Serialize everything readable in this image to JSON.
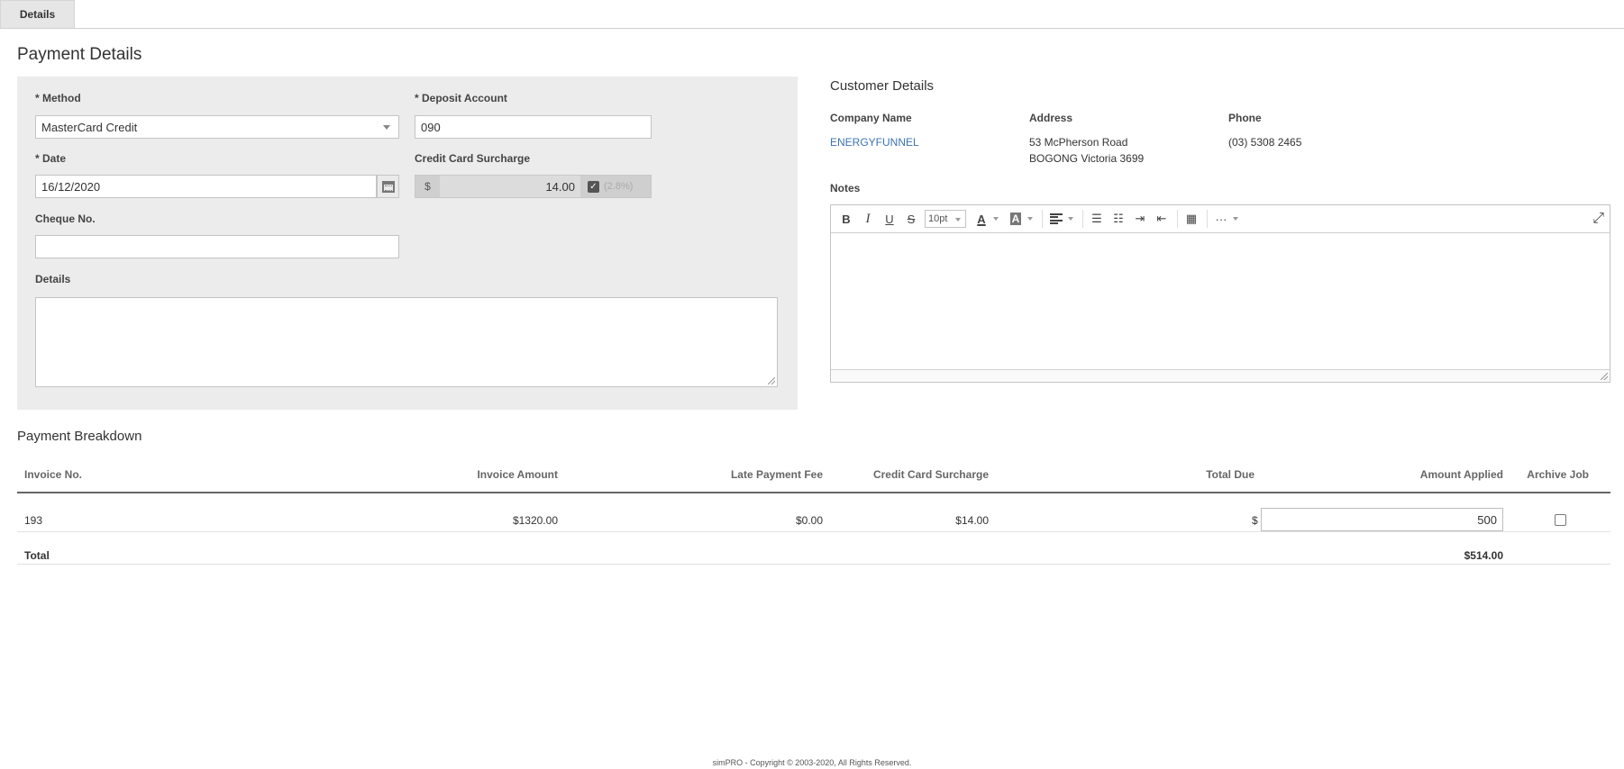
{
  "tabs": [
    {
      "label": "Details"
    }
  ],
  "page_title": "Payment Details",
  "form": {
    "method_label": "* Method",
    "method_value": "MasterCard Credit",
    "deposit_label": "* Deposit Account",
    "deposit_value": "090",
    "date_label": "* Date",
    "date_value": "16/12/2020",
    "surcharge_label": "Credit Card Surcharge",
    "surcharge_currency": "$",
    "surcharge_value": "14.00",
    "surcharge_percent": "(2.8%)",
    "surcharge_checked": true,
    "cheque_label": "Cheque No.",
    "cheque_value": "",
    "details_label": "Details",
    "details_value": ""
  },
  "customer": {
    "title": "Customer Details",
    "company_header": "Company Name",
    "company_value": "ENERGYFUNNEL",
    "address_header": "Address",
    "address_line1": "53 McPherson Road",
    "address_line2": "BOGONG Victoria 3699",
    "phone_header": "Phone",
    "phone_value": "(03) 5308 2465"
  },
  "notes": {
    "label": "Notes",
    "font_size": "10pt",
    "content": ""
  },
  "breakdown": {
    "title": "Payment Breakdown",
    "columns": [
      "Invoice No.",
      "Invoice Amount",
      "Late Payment Fee",
      "Credit Card Surcharge",
      "Total Due",
      "Amount Applied",
      "Archive Job"
    ],
    "rows": [
      {
        "invoice_no": "193",
        "invoice_amount": "$1320.00",
        "late_fee": "$0.00",
        "surcharge": "$14.00",
        "currency": "$",
        "amount_applied": "500",
        "archive": false
      }
    ],
    "total_label": "Total",
    "total_value": "$514.00"
  },
  "footer": "simPRO - Copyright © 2003-2020, All Rights Reserved.",
  "colors": {
    "link": "#3a74b5",
    "panel": "#ececec"
  }
}
